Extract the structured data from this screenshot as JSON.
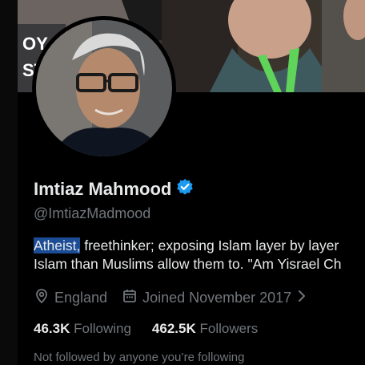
{
  "profile": {
    "name": "Imtiaz Mahmood",
    "handle": "@ImtiazMadmood",
    "verified": true,
    "bio_highlight": "Atheist,",
    "bio_line1_rest": " freethinker; exposing Islam layer by layer",
    "bio_line2": "Islam than Muslims allow them to. \"Am Yisrael Ch",
    "location": "England",
    "joined": "Joined November 2017",
    "following_count": "46.3K",
    "following_label": "Following",
    "followers_count": "462.5K",
    "followers_label": "Followers",
    "not_followed": "Not followed by anyone you’re following"
  },
  "banner_text": "OY\nST",
  "colors": {
    "verified": "#1d9bf0",
    "selection": "#1c4c96",
    "muted": "#71767b",
    "lanyard": "#5fd35a"
  }
}
